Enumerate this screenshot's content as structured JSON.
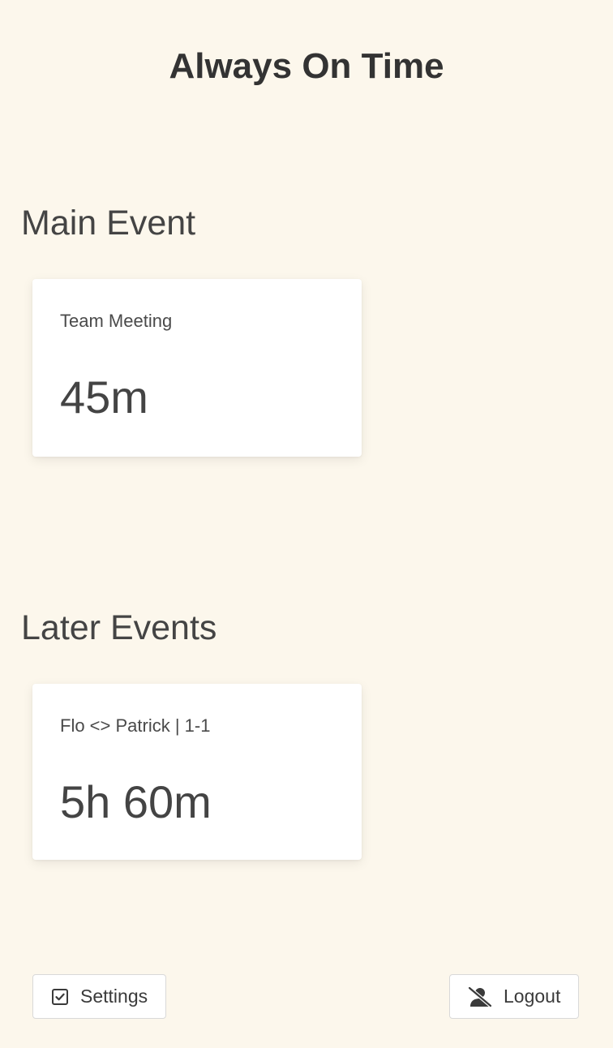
{
  "header": {
    "title": "Always On Time"
  },
  "main_event": {
    "section_title": "Main Event",
    "event": {
      "name": "Team Meeting",
      "countdown": "45m"
    }
  },
  "later_events": {
    "section_title": "Later Events",
    "events": [
      {
        "name": "Flo <> Patrick | 1-1",
        "countdown": "5h 60m"
      }
    ]
  },
  "footer": {
    "settings": {
      "label": "Settings",
      "icon": "checkbox-checked-icon"
    },
    "logout": {
      "label": "Logout",
      "icon": "user-slash-icon"
    }
  },
  "colors": {
    "background": "#fcf7ec",
    "card": "#ffffff",
    "text": "#444444"
  }
}
